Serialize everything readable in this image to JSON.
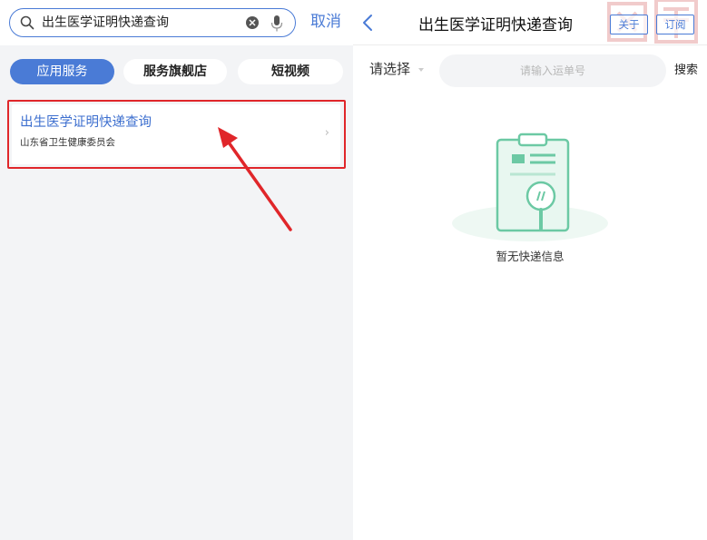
{
  "left": {
    "search": {
      "query": "出生医学证明快递查询",
      "cancel_label": "取消"
    },
    "tabs": [
      {
        "label": "应用服务",
        "active": true
      },
      {
        "label": "服务旗舰店",
        "active": false
      },
      {
        "label": "短视频",
        "active": false
      }
    ],
    "result": {
      "title": "出生医学证明快递查询",
      "subtitle": "山东省卫生健康委员会",
      "chevron": "›"
    }
  },
  "right": {
    "nav": {
      "title": "出生医学证明快递查询",
      "about_label": "关于",
      "subscribe_label": "订阅"
    },
    "filter": {
      "select_label": "请选择",
      "input_placeholder": "请输入运单号",
      "search_label": "搜索"
    },
    "empty": {
      "message": "暂无快递信息"
    }
  },
  "colors": {
    "accent": "#4a7bd6",
    "highlight": "#e0262a",
    "illustration": "#6cc9a4"
  },
  "icons": [
    "search-icon",
    "clear-icon",
    "microphone-icon",
    "chevron-right-icon",
    "back-icon",
    "dropdown-caret-icon",
    "clipboard-illustration"
  ]
}
